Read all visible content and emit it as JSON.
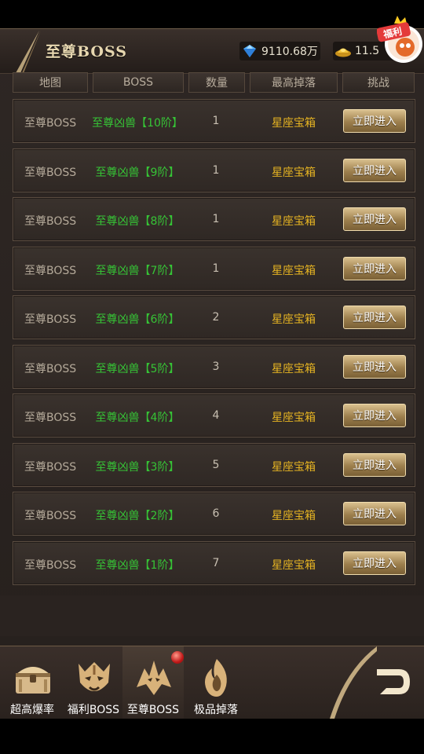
{
  "header": {
    "title": "至尊BOSS",
    "diamond_amount": "9110.68万",
    "gold_amount": "11.5",
    "fuli_label": "福利"
  },
  "columns": [
    "地图",
    "BOSS",
    "数量",
    "最高掉落",
    "挑战"
  ],
  "rows": [
    {
      "map": "至尊BOSS",
      "boss": "至尊凶兽【10阶】",
      "count": "1",
      "drop": "星座宝箱",
      "action": "立即进入"
    },
    {
      "map": "至尊BOSS",
      "boss": "至尊凶兽【9阶】",
      "count": "1",
      "drop": "星座宝箱",
      "action": "立即进入"
    },
    {
      "map": "至尊BOSS",
      "boss": "至尊凶兽【8阶】",
      "count": "1",
      "drop": "星座宝箱",
      "action": "立即进入"
    },
    {
      "map": "至尊BOSS",
      "boss": "至尊凶兽【7阶】",
      "count": "1",
      "drop": "星座宝箱",
      "action": "立即进入"
    },
    {
      "map": "至尊BOSS",
      "boss": "至尊凶兽【6阶】",
      "count": "2",
      "drop": "星座宝箱",
      "action": "立即进入"
    },
    {
      "map": "至尊BOSS",
      "boss": "至尊凶兽【5阶】",
      "count": "3",
      "drop": "星座宝箱",
      "action": "立即进入"
    },
    {
      "map": "至尊BOSS",
      "boss": "至尊凶兽【4阶】",
      "count": "4",
      "drop": "星座宝箱",
      "action": "立即进入"
    },
    {
      "map": "至尊BOSS",
      "boss": "至尊凶兽【3阶】",
      "count": "5",
      "drop": "星座宝箱",
      "action": "立即进入"
    },
    {
      "map": "至尊BOSS",
      "boss": "至尊凶兽【2阶】",
      "count": "6",
      "drop": "星座宝箱",
      "action": "立即进入"
    },
    {
      "map": "至尊BOSS",
      "boss": "至尊凶兽【1阶】",
      "count": "7",
      "drop": "星座宝箱",
      "action": "立即进入"
    }
  ],
  "nav": {
    "tabs": [
      {
        "label": "超高爆率",
        "icon": "treasure-chest-icon"
      },
      {
        "label": "福利BOSS",
        "icon": "tiger-mask-icon"
      },
      {
        "label": "至尊BOSS",
        "icon": "dragon-icon",
        "active": true,
        "badge": true
      },
      {
        "label": "极品掉落",
        "icon": "flame-gem-icon"
      }
    ],
    "back_icon": "back-arrow-icon"
  },
  "colors": {
    "boss_name": "#36c436",
    "drop": "#e6b422",
    "button": "#9d7f4d"
  }
}
